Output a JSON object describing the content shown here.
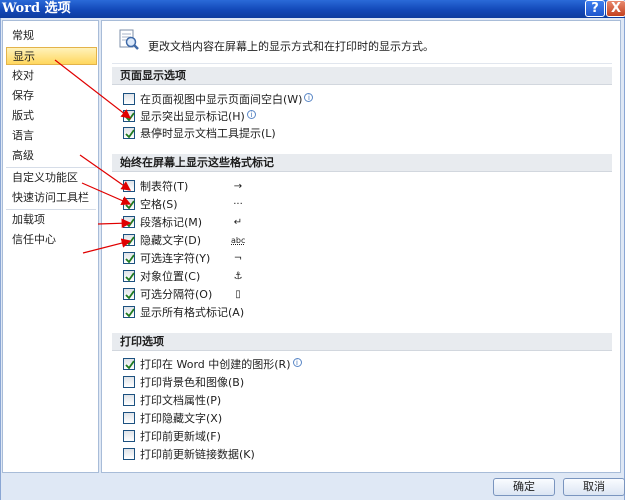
{
  "window": {
    "title": "Word 选项",
    "help": "?",
    "close": "X"
  },
  "sidebar": {
    "items": [
      {
        "label": "常规"
      },
      {
        "label": "显示"
      },
      {
        "label": "校对"
      },
      {
        "label": "保存"
      },
      {
        "label": "版式"
      },
      {
        "label": "语言"
      },
      {
        "label": "高级"
      },
      {
        "label": "自定义功能区"
      },
      {
        "label": "快速访问工具栏"
      },
      {
        "label": "加载项"
      },
      {
        "label": "信任中心"
      }
    ],
    "active": "显示"
  },
  "content": {
    "description": "更改文档内容在屏幕上的显示方式和在打印时的显示方式。",
    "page_display": {
      "heading": "页面显示选项",
      "options": [
        {
          "label": "在页面视图中显示页面间空白(W)",
          "checked": false,
          "info": true
        },
        {
          "label": "显示突出显示标记(H)",
          "checked": true,
          "info": true
        },
        {
          "label": "悬停时显示文档工具提示(L)",
          "checked": true,
          "info": false
        }
      ]
    },
    "formatting_marks": {
      "heading": "始终在屏幕上显示这些格式标记",
      "options": [
        {
          "label": "制表符(T)",
          "checked": false,
          "symbol": "→"
        },
        {
          "label": "空格(S)",
          "checked": true,
          "symbol": "···"
        },
        {
          "label": "段落标记(M)",
          "checked": true,
          "symbol": "↵"
        },
        {
          "label": "隐藏文字(D)",
          "checked": true,
          "symbol": "abc"
        },
        {
          "label": "可选连字符(Y)",
          "checked": true,
          "symbol": "¬"
        },
        {
          "label": "对象位置(C)",
          "checked": true,
          "symbol": "⚓"
        },
        {
          "label": "可选分隔符(O)",
          "checked": true,
          "symbol": "▯"
        },
        {
          "label": "显示所有格式标记(A)",
          "checked": true,
          "symbol": ""
        }
      ]
    },
    "print_options": {
      "heading": "打印选项",
      "options": [
        {
          "label": "打印在 Word 中创建的图形(R)",
          "checked": true,
          "info": true
        },
        {
          "label": "打印背景色和图像(B)",
          "checked": false,
          "info": false
        },
        {
          "label": "打印文档属性(P)",
          "checked": false,
          "info": false
        },
        {
          "label": "打印隐藏文字(X)",
          "checked": false,
          "info": false
        },
        {
          "label": "打印前更新域(F)",
          "checked": false,
          "info": false
        },
        {
          "label": "打印前更新链接数据(K)",
          "checked": false,
          "info": false
        }
      ]
    }
  },
  "footer": {
    "ok_label": "确定",
    "cancel_label": "取消"
  },
  "colors": {
    "titlebar": "#1248b8",
    "accent": "#ffd75e",
    "annotation_arrow": "#e00000",
    "check": "#1f7a1f"
  }
}
